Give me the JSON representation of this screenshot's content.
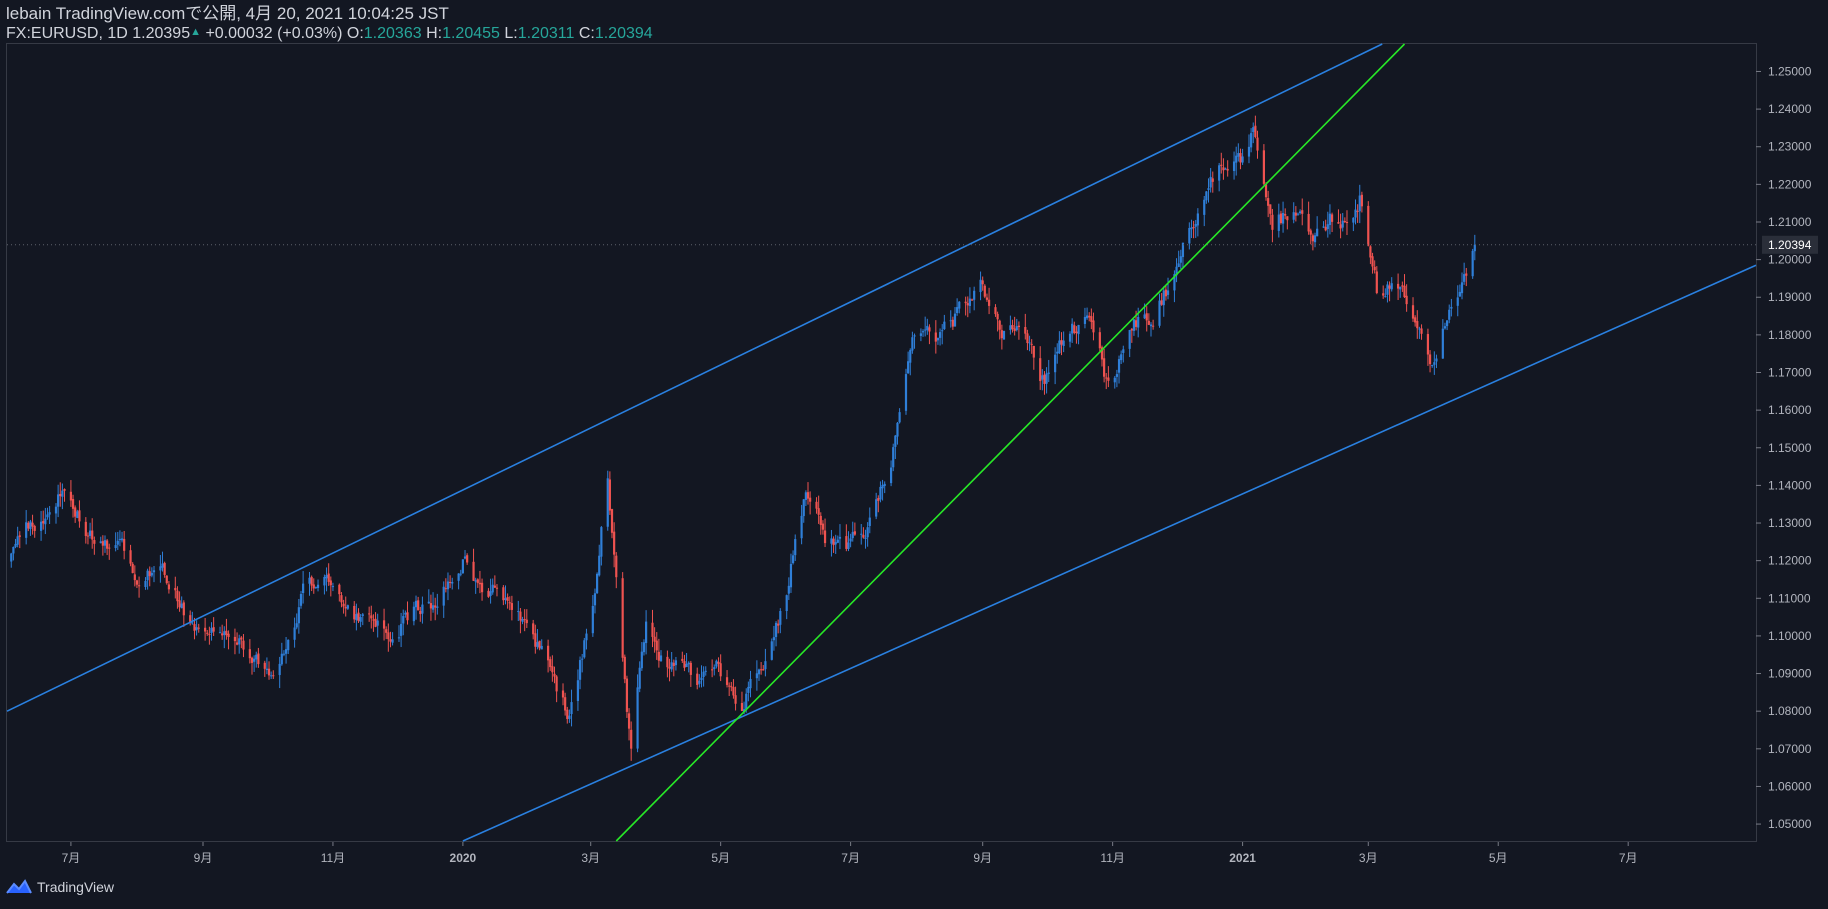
{
  "header": {
    "published_line": "lebain TradingView.comで公開, 4月 20, 2021 10:04:25 JST",
    "symbol": "FX:EURUSD, 1D",
    "last": "1.20395",
    "change": "+0.00032 (+0.03%)",
    "o_label": "O:",
    "o_value": "1.20363",
    "h_label": "H:",
    "h_value": "1.20455",
    "l_label": "L:",
    "l_value": "1.20311",
    "c_label": "C:",
    "c_value": "1.20394"
  },
  "footer": {
    "logo_icon": "tradingview-logo-icon",
    "brand": "TradingView"
  },
  "colors": {
    "background": "#131722",
    "up": "#2f7fd8",
    "down": "#ef5350",
    "trendline": "#2a80e0",
    "green_line": "#27e827",
    "axis_text": "#b2b5be",
    "price_label_bg": "#2a2e39"
  },
  "chart_data": {
    "type": "candlestick",
    "symbol": "FX:EURUSD",
    "interval": "1D",
    "y_ticks": [
      "1.25000",
      "1.24000",
      "1.23000",
      "1.22000",
      "1.21000",
      "1.20000",
      "1.19000",
      "1.18000",
      "1.17000",
      "1.16000",
      "1.15000",
      "1.14000",
      "1.13000",
      "1.12000",
      "1.11000",
      "1.10000",
      "1.09000",
      "1.08000",
      "1.07000",
      "1.06000",
      "1.05000"
    ],
    "ylim": [
      1.0455,
      1.2573
    ],
    "x_ticks": [
      {
        "label": "7月",
        "date": "2019-07-01"
      },
      {
        "label": "9月",
        "date": "2019-09-01"
      },
      {
        "label": "11月",
        "date": "2019-11-01"
      },
      {
        "label": "2020",
        "date": "2020-01-01",
        "bold": true
      },
      {
        "label": "3月",
        "date": "2020-03-01"
      },
      {
        "label": "5月",
        "date": "2020-05-01"
      },
      {
        "label": "7月",
        "date": "2020-07-01"
      },
      {
        "label": "9月",
        "date": "2020-09-01"
      },
      {
        "label": "11月",
        "date": "2020-11-01"
      },
      {
        "label": "2021",
        "date": "2021-01-01",
        "bold": true
      },
      {
        "label": "3月",
        "date": "2021-03-01"
      },
      {
        "label": "5月",
        "date": "2021-05-01"
      },
      {
        "label": "7月",
        "date": "2021-07-01"
      }
    ],
    "xlim": [
      "2019-06-01",
      "2021-08-30"
    ],
    "last_price_label": "1.20394",
    "trendlines": [
      {
        "name": "upper-channel",
        "color": "trendline",
        "p1": {
          "date": "2019-06-01",
          "price": 1.08
        },
        "p2": {
          "date": "2021-03-01",
          "price": 1.2555
        }
      },
      {
        "name": "lower-channel",
        "color": "trendline",
        "p1": {
          "date": "2020-01-01",
          "price": 1.0455
        },
        "p2": {
          "date": "2021-08-30",
          "price": 1.1985
        }
      },
      {
        "name": "green-support",
        "color": "green_line",
        "p1": {
          "date": "2020-03-13",
          "price": 1.0455
        },
        "p2": {
          "date": "2021-03-18",
          "price": 1.2573
        }
      }
    ],
    "series": [
      {
        "name": "EURUSD",
        "anchors": [
          [
            "2019-06-03",
            1.12
          ],
          [
            "2019-06-10",
            1.128
          ],
          [
            "2019-06-20",
            1.134
          ],
          [
            "2019-06-28",
            1.14
          ],
          [
            "2019-07-05",
            1.132
          ],
          [
            "2019-07-15",
            1.124
          ],
          [
            "2019-07-25",
            1.126
          ],
          [
            "2019-08-01",
            1.113
          ],
          [
            "2019-08-10",
            1.12
          ],
          [
            "2019-08-20",
            1.11
          ],
          [
            "2019-09-01",
            1.098
          ],
          [
            "2019-09-10",
            1.103
          ],
          [
            "2019-09-20",
            1.096
          ],
          [
            "2019-10-01",
            1.09
          ],
          [
            "2019-10-10",
            1.097
          ],
          [
            "2019-10-20",
            1.115
          ],
          [
            "2019-10-30",
            1.116
          ],
          [
            "2019-11-10",
            1.104
          ],
          [
            "2019-11-20",
            1.106
          ],
          [
            "2019-11-29",
            1.101
          ],
          [
            "2019-12-10",
            1.108
          ],
          [
            "2019-12-20",
            1.11
          ],
          [
            "2020-01-01",
            1.12
          ],
          [
            "2020-01-10",
            1.112
          ],
          [
            "2020-01-20",
            1.11
          ],
          [
            "2020-01-31",
            1.104
          ],
          [
            "2020-02-10",
            1.092
          ],
          [
            "2020-02-20",
            1.079
          ],
          [
            "2020-03-01",
            1.105
          ],
          [
            "2020-03-09",
            1.143
          ],
          [
            "2020-03-13",
            1.115
          ],
          [
            "2020-03-20",
            1.069
          ],
          [
            "2020-03-27",
            1.105
          ],
          [
            "2020-04-01",
            1.096
          ],
          [
            "2020-04-10",
            1.092
          ],
          [
            "2020-04-20",
            1.088
          ],
          [
            "2020-04-30",
            1.092
          ],
          [
            "2020-05-10",
            1.082
          ],
          [
            "2020-05-20",
            1.09
          ],
          [
            "2020-05-31",
            1.11
          ],
          [
            "2020-06-10",
            1.137
          ],
          [
            "2020-06-20",
            1.125
          ],
          [
            "2020-06-30",
            1.123
          ],
          [
            "2020-07-10",
            1.13
          ],
          [
            "2020-07-20",
            1.145
          ],
          [
            "2020-07-31",
            1.179
          ],
          [
            "2020-08-10",
            1.179
          ],
          [
            "2020-08-20",
            1.185
          ],
          [
            "2020-08-31",
            1.195
          ],
          [
            "2020-09-10",
            1.182
          ],
          [
            "2020-09-20",
            1.185
          ],
          [
            "2020-09-28",
            1.165
          ],
          [
            "2020-10-10",
            1.18
          ],
          [
            "2020-10-20",
            1.183
          ],
          [
            "2020-10-31",
            1.165
          ],
          [
            "2020-11-10",
            1.182
          ],
          [
            "2020-11-20",
            1.186
          ],
          [
            "2020-11-30",
            1.196
          ],
          [
            "2020-12-10",
            1.212
          ],
          [
            "2020-12-20",
            1.223
          ],
          [
            "2020-12-31",
            1.225
          ],
          [
            "2021-01-06",
            1.233
          ],
          [
            "2021-01-15",
            1.208
          ],
          [
            "2021-01-25",
            1.215
          ],
          [
            "2021-02-03",
            1.204
          ],
          [
            "2021-02-10",
            1.211
          ],
          [
            "2021-02-20",
            1.212
          ],
          [
            "2021-02-25",
            1.217
          ],
          [
            "2021-03-05",
            1.192
          ],
          [
            "2021-03-15",
            1.194
          ],
          [
            "2021-03-25",
            1.18
          ],
          [
            "2021-03-31",
            1.173
          ],
          [
            "2021-04-10",
            1.189
          ],
          [
            "2021-04-20",
            1.2039
          ]
        ]
      }
    ]
  }
}
